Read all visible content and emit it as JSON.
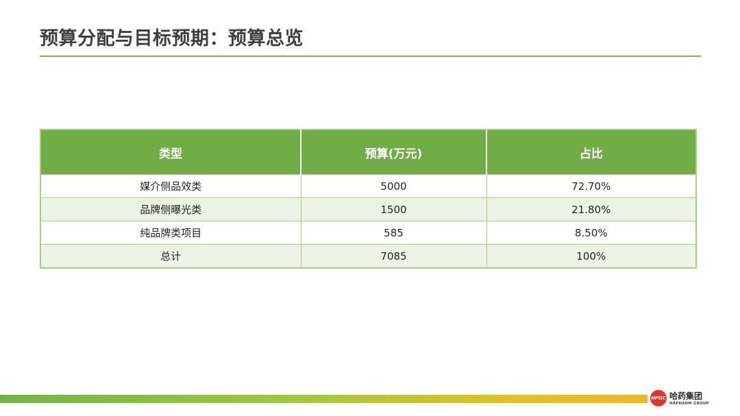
{
  "page": {
    "title": "预算分配与目标预期：预算总览"
  },
  "table": {
    "headers": [
      "类型",
      "预算(万元)",
      "占比"
    ],
    "rows": [
      [
        "媒介侧品效类",
        "5000",
        "72.70%"
      ],
      [
        "品牌侧曝光类",
        "1500",
        "21.80%"
      ],
      [
        "纯品牌类项目",
        "585",
        "8.50%"
      ],
      [
        "总计",
        "7085",
        "100%"
      ]
    ]
  },
  "logo": {
    "mark": "HPGC",
    "name_cn": "哈药集团",
    "name_en": "HAPHARM GROUP"
  },
  "colors": {
    "accent": "#70ad47",
    "row_alt": "#ebf3e4",
    "logo_red": "#e2322a"
  }
}
